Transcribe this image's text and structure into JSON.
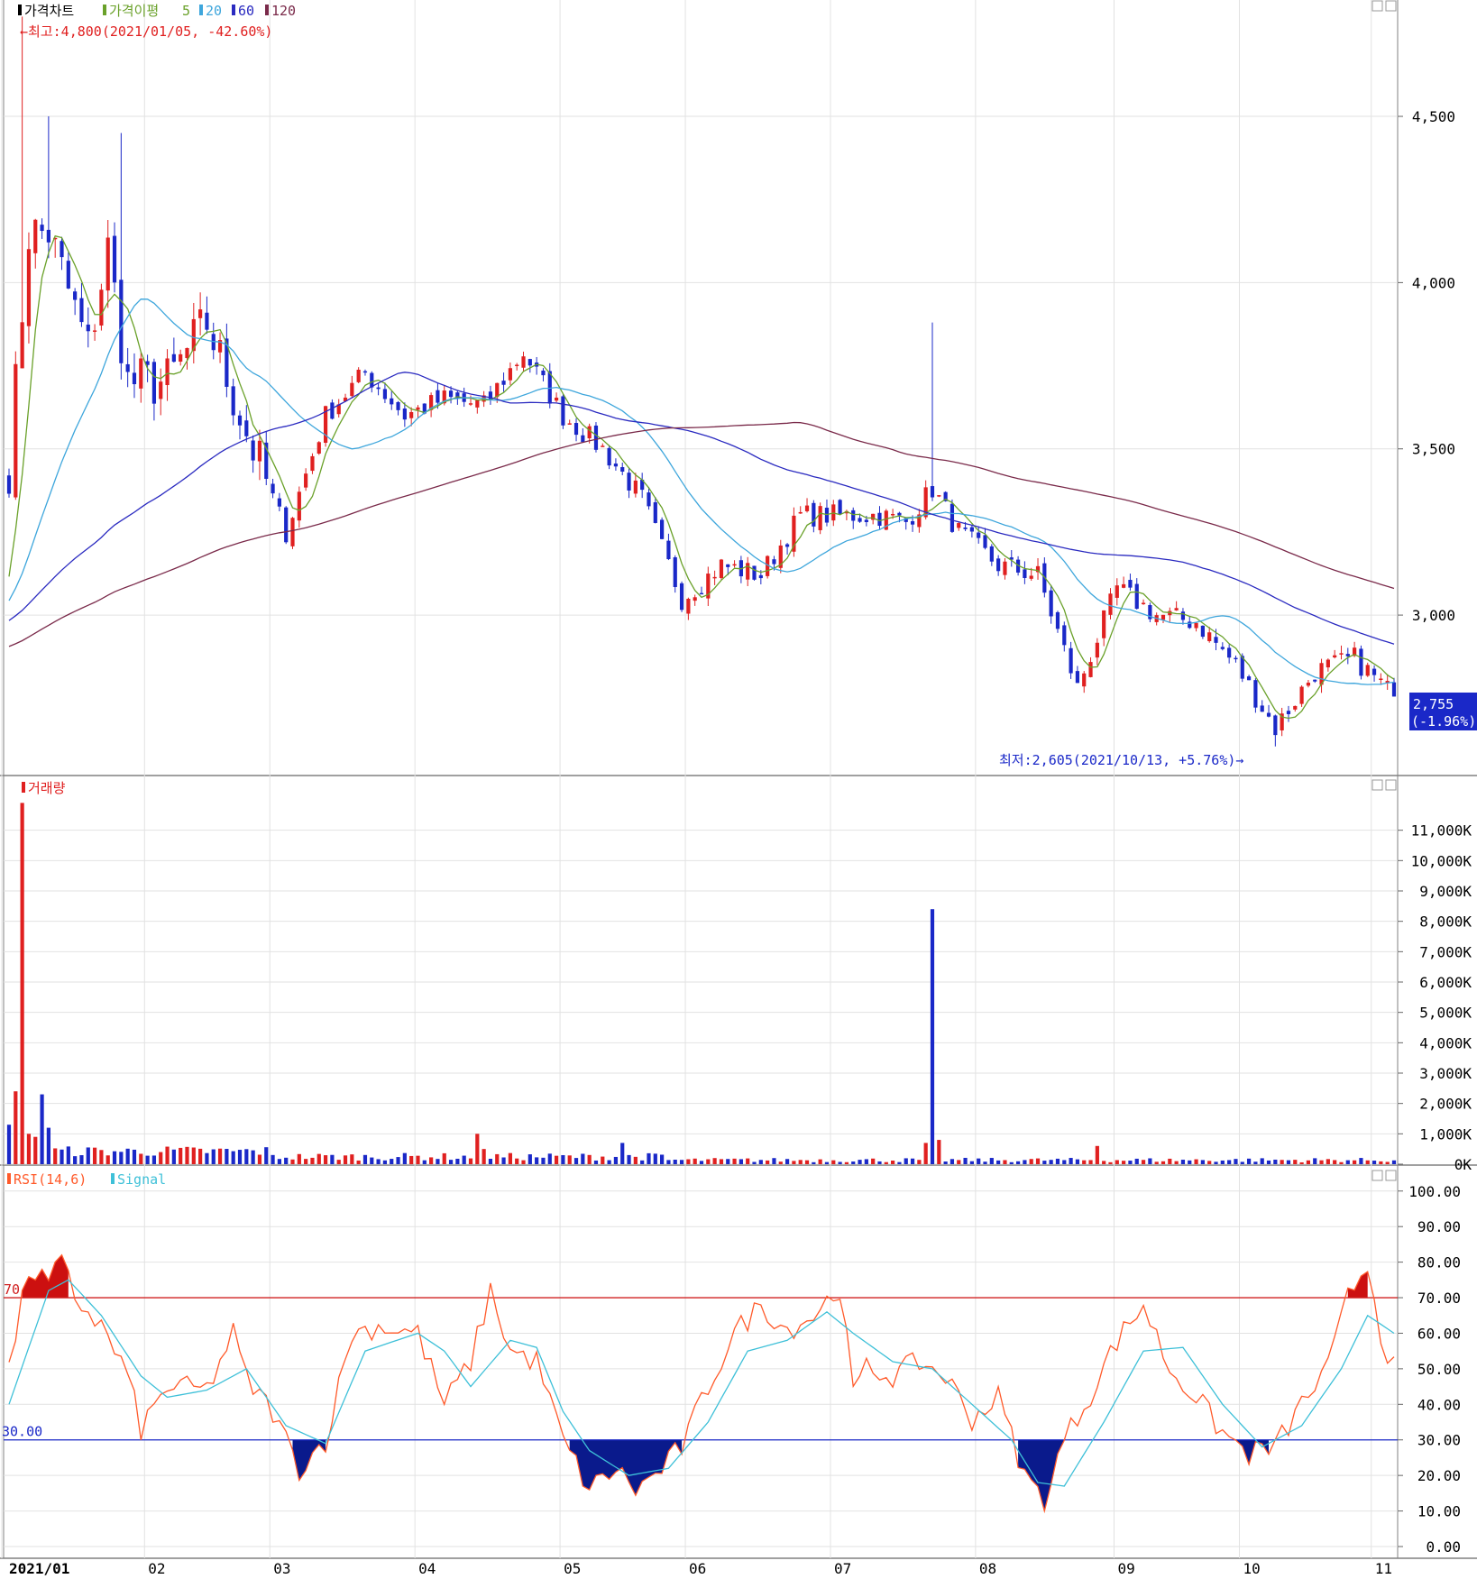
{
  "legend": {
    "price_title": "가격차트",
    "ma_label": "가격이평",
    "ma_values": [
      "5",
      "20",
      "60",
      "120"
    ],
    "volume_title": "거래량",
    "rsi_title": "RSI(14,6)",
    "signal_title": "Signal"
  },
  "annotations": {
    "high": "←최고:4,800(2021/01/05, -42.60%)",
    "low": "최저:2,605(2021/10/13, +5.76%)→",
    "last_price": "2,755",
    "last_change": "(-1.96%)"
  },
  "colors": {
    "up": "#e02020",
    "down": "#1a28c8",
    "ma5": "#6aa12a",
    "ma20": "#3ea6dc",
    "ma60": "#2a2ac0",
    "ma120": "#7a2a4a",
    "rsi": "#ff5a2a",
    "signal": "#3ec0d8",
    "overbought_fill": "#cc1010",
    "oversold_fill": "#0a1a8c",
    "grid": "#e2e2e2"
  },
  "chart_data": [
    {
      "type": "candlestick",
      "panel": "price",
      "y_ticks": [
        {
          "v": 4500,
          "label": "4,500"
        },
        {
          "v": 4000,
          "label": "4,000"
        },
        {
          "v": 3500,
          "label": "3,500"
        },
        {
          "v": 3000,
          "label": "3,000"
        }
      ],
      "ylim": [
        2550,
        4850
      ],
      "high": {
        "value": 4800,
        "date": "2021/01/05"
      },
      "low": {
        "value": 2605,
        "date": "2021/10/13"
      },
      "last": 2755,
      "start_value": 3450,
      "anchors": [
        [
          0,
          3450
        ],
        [
          3,
          4150
        ],
        [
          6,
          4150
        ],
        [
          12,
          3800
        ],
        [
          15,
          4100
        ],
        [
          18,
          3700
        ],
        [
          24,
          3700
        ],
        [
          30,
          3880
        ],
        [
          36,
          3550
        ],
        [
          42,
          3250
        ],
        [
          48,
          3600
        ],
        [
          54,
          3730
        ],
        [
          60,
          3600
        ],
        [
          66,
          3650
        ],
        [
          72,
          3630
        ],
        [
          78,
          3790
        ],
        [
          84,
          3600
        ],
        [
          90,
          3500
        ],
        [
          96,
          3350
        ],
        [
          102,
          3050
        ],
        [
          108,
          3150
        ],
        [
          114,
          3120
        ],
        [
          120,
          3300
        ],
        [
          126,
          3300
        ],
        [
          132,
          3300
        ],
        [
          136,
          3280
        ],
        [
          140,
          3380
        ],
        [
          144,
          3250
        ],
        [
          150,
          3150
        ],
        [
          156,
          3120
        ],
        [
          162,
          2780
        ],
        [
          168,
          3080
        ],
        [
          174,
          3000
        ],
        [
          180,
          2980
        ],
        [
          186,
          2850
        ],
        [
          192,
          2660
        ],
        [
          198,
          2830
        ],
        [
          204,
          2870
        ],
        [
          210,
          2755
        ]
      ],
      "spikes": [
        {
          "i": 2,
          "high": 4800
        },
        {
          "i": 6,
          "high": 4500
        },
        {
          "i": 17,
          "high": 4450
        },
        {
          "i": 140,
          "high": 3880
        }
      ],
      "moving_averages": [
        "5",
        "20",
        "60",
        "120"
      ]
    },
    {
      "type": "bar",
      "panel": "volume",
      "y_ticks": [
        {
          "v": 0,
          "label": "0K"
        },
        {
          "v": 1000,
          "label": "1,000K"
        },
        {
          "v": 2000,
          "label": "2,000K"
        },
        {
          "v": 3000,
          "label": "3,000K"
        },
        {
          "v": 4000,
          "label": "4,000K"
        },
        {
          "v": 5000,
          "label": "5,000K"
        },
        {
          "v": 6000,
          "label": "6,000K"
        },
        {
          "v": 7000,
          "label": "7,000K"
        },
        {
          "v": 8000,
          "label": "8,000K"
        },
        {
          "v": 9000,
          "label": "9,000K"
        },
        {
          "v": 10000,
          "label": "10,000K"
        },
        {
          "v": 11000,
          "label": "11,000K"
        }
      ],
      "ylim": [
        0,
        12000
      ],
      "peaks": [
        {
          "i": 0,
          "v": 1300
        },
        {
          "i": 1,
          "v": 2400
        },
        {
          "i": 2,
          "v": 11900
        },
        {
          "i": 3,
          "v": 1000
        },
        {
          "i": 4,
          "v": 900
        },
        {
          "i": 5,
          "v": 2300
        },
        {
          "i": 6,
          "v": 1200
        },
        {
          "i": 71,
          "v": 1000
        },
        {
          "i": 72,
          "v": 500
        },
        {
          "i": 93,
          "v": 700
        },
        {
          "i": 140,
          "v": 8400
        },
        {
          "i": 141,
          "v": 800
        },
        {
          "i": 139,
          "v": 700
        },
        {
          "i": 165,
          "v": 600
        }
      ]
    },
    {
      "type": "line",
      "panel": "rsi",
      "y_ticks": [
        {
          "v": 0,
          "label": "0.00"
        },
        {
          "v": 10,
          "label": "10.00"
        },
        {
          "v": 20,
          "label": "20.00"
        },
        {
          "v": 30,
          "label": "30.00"
        },
        {
          "v": 40,
          "label": "40.00"
        },
        {
          "v": 50,
          "label": "50.00"
        },
        {
          "v": 60,
          "label": "60.00"
        },
        {
          "v": 70,
          "label": "70.00"
        },
        {
          "v": 80,
          "label": "80.00"
        },
        {
          "v": 90,
          "label": "90.00"
        },
        {
          "v": 100,
          "label": "100.00"
        }
      ],
      "ylim": [
        0,
        104
      ],
      "upper": 70,
      "lower": 30,
      "upper_label": "70",
      "lower_label": "30.00",
      "rsi_anchors": [
        [
          0,
          50
        ],
        [
          3,
          78
        ],
        [
          6,
          74
        ],
        [
          8,
          80
        ],
        [
          10,
          70
        ],
        [
          14,
          62
        ],
        [
          18,
          48
        ],
        [
          20,
          33
        ],
        [
          24,
          45
        ],
        [
          30,
          44
        ],
        [
          34,
          60
        ],
        [
          36,
          47
        ],
        [
          40,
          38
        ],
        [
          44,
          22
        ],
        [
          48,
          30
        ],
        [
          52,
          60
        ],
        [
          56,
          62
        ],
        [
          62,
          60
        ],
        [
          66,
          40
        ],
        [
          70,
          52
        ],
        [
          73,
          72
        ],
        [
          76,
          55
        ],
        [
          80,
          52
        ],
        [
          84,
          30
        ],
        [
          88,
          16
        ],
        [
          92,
          22
        ],
        [
          95,
          16
        ],
        [
          98,
          20
        ],
        [
          102,
          28
        ],
        [
          106,
          45
        ],
        [
          110,
          60
        ],
        [
          114,
          68
        ],
        [
          118,
          61
        ],
        [
          122,
          65
        ],
        [
          126,
          73
        ],
        [
          128,
          43
        ],
        [
          130,
          50
        ],
        [
          134,
          48
        ],
        [
          138,
          52
        ],
        [
          142,
          48
        ],
        [
          146,
          36
        ],
        [
          150,
          42
        ],
        [
          154,
          20
        ],
        [
          157,
          13
        ],
        [
          160,
          30
        ],
        [
          164,
          43
        ],
        [
          168,
          58
        ],
        [
          172,
          68
        ],
        [
          176,
          50
        ],
        [
          180,
          42
        ],
        [
          184,
          32
        ],
        [
          188,
          26
        ],
        [
          192,
          28
        ],
        [
          196,
          40
        ],
        [
          200,
          50
        ],
        [
          203,
          70
        ],
        [
          206,
          80
        ],
        [
          208,
          60
        ],
        [
          210,
          50
        ]
      ],
      "signal_anchors": [
        [
          0,
          40
        ],
        [
          6,
          72
        ],
        [
          9,
          75
        ],
        [
          14,
          65
        ],
        [
          20,
          48
        ],
        [
          24,
          42
        ],
        [
          30,
          44
        ],
        [
          36,
          50
        ],
        [
          42,
          34
        ],
        [
          48,
          29
        ],
        [
          54,
          55
        ],
        [
          62,
          60
        ],
        [
          66,
          55
        ],
        [
          70,
          45
        ],
        [
          76,
          58
        ],
        [
          80,
          56
        ],
        [
          84,
          38
        ],
        [
          88,
          27
        ],
        [
          94,
          20
        ],
        [
          100,
          22
        ],
        [
          106,
          35
        ],
        [
          112,
          55
        ],
        [
          118,
          58
        ],
        [
          124,
          66
        ],
        [
          128,
          60
        ],
        [
          134,
          52
        ],
        [
          140,
          50
        ],
        [
          146,
          40
        ],
        [
          152,
          30
        ],
        [
          156,
          18
        ],
        [
          160,
          17
        ],
        [
          166,
          35
        ],
        [
          172,
          55
        ],
        [
          178,
          56
        ],
        [
          184,
          40
        ],
        [
          190,
          28
        ],
        [
          196,
          34
        ],
        [
          202,
          50
        ],
        [
          206,
          65
        ],
        [
          210,
          60
        ]
      ]
    }
  ],
  "x_axis": [
    {
      "i": 0,
      "label": "2021/01",
      "bold": true
    },
    {
      "i": 20,
      "label": "02"
    },
    {
      "i": 39,
      "label": "03"
    },
    {
      "i": 61,
      "label": "04"
    },
    {
      "i": 83,
      "label": "05"
    },
    {
      "i": 102,
      "label": "06"
    },
    {
      "i": 124,
      "label": "07"
    },
    {
      "i": 146,
      "label": "08"
    },
    {
      "i": 167,
      "label": "09"
    },
    {
      "i": 186,
      "label": "10"
    },
    {
      "i": 206,
      "label": "11"
    }
  ],
  "bar_count": 211
}
